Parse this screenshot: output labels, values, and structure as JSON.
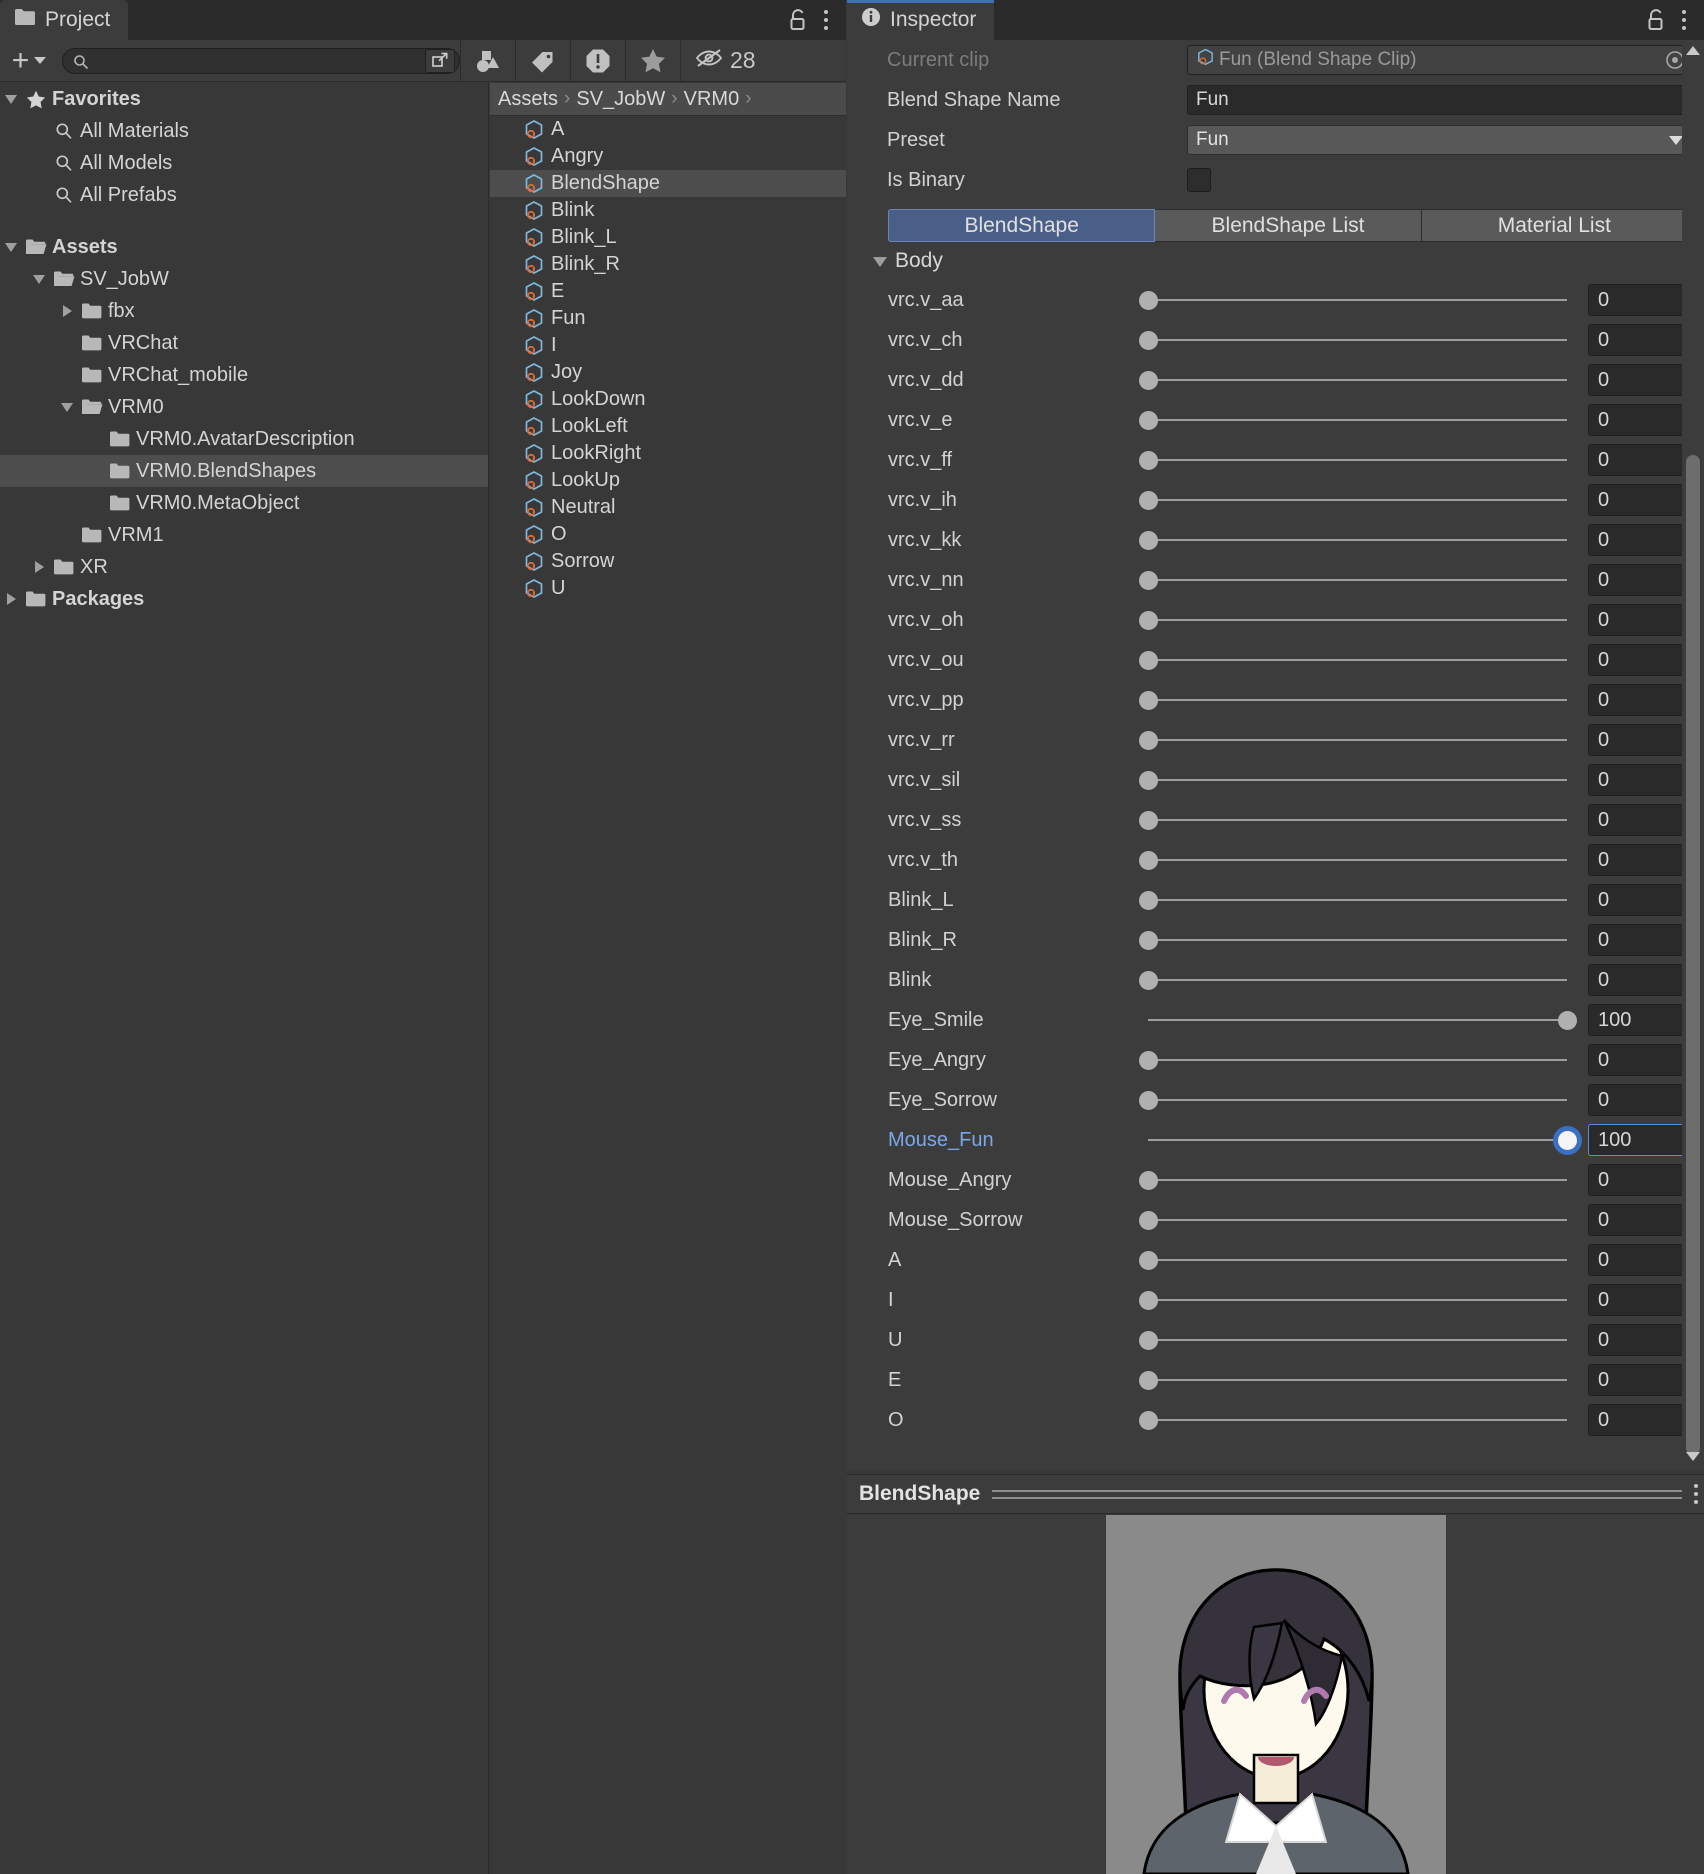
{
  "project_panel": {
    "tab_label": "Project",
    "tab_icon": "folder-icon",
    "lock_icon": "lock-open-icon",
    "menu_icon": "kebab-menu-icon",
    "toolbar": {
      "create_label": "+",
      "create_dropdown_icon": "chevron-down-icon",
      "search_value": "",
      "search_placeholder": "",
      "search_icon": "search-icon",
      "search_expand_icon": "open-in-new-window-icon",
      "filter_type_icon": "shapes-filter-icon",
      "filter_label_icon": "tag-filter-icon",
      "filter_warning_icon": "warning-octagon-icon",
      "filter_favorite_icon": "star-filter-icon",
      "hidden_icon": "eye-slash-icon",
      "hidden_count": "28"
    },
    "tree": [
      {
        "label": "Favorites",
        "icon": "star-icon",
        "indent": 0,
        "expander": "down",
        "bold": true,
        "selected": false
      },
      {
        "label": "All Materials",
        "icon": "search-icon",
        "indent": 1,
        "expander": "none",
        "bold": false,
        "selected": false
      },
      {
        "label": "All Models",
        "icon": "search-icon",
        "indent": 1,
        "expander": "none",
        "bold": false,
        "selected": false
      },
      {
        "label": "All Prefabs",
        "icon": "search-icon",
        "indent": 1,
        "expander": "none",
        "bold": false,
        "selected": false
      },
      {
        "label": "",
        "icon": "none",
        "indent": 0,
        "expander": "none",
        "bold": false,
        "selected": false
      },
      {
        "label": "Assets",
        "icon": "folder-open-icon",
        "indent": 0,
        "expander": "down",
        "bold": true,
        "selected": false
      },
      {
        "label": "SV_JobW",
        "icon": "folder-open-icon",
        "indent": 1,
        "expander": "down",
        "bold": false,
        "selected": false
      },
      {
        "label": "fbx",
        "icon": "folder-icon",
        "indent": 2,
        "expander": "right",
        "bold": false,
        "selected": false
      },
      {
        "label": "VRChat",
        "icon": "folder-icon",
        "indent": 2,
        "expander": "none",
        "bold": false,
        "selected": false
      },
      {
        "label": "VRChat_mobile",
        "icon": "folder-icon",
        "indent": 2,
        "expander": "none",
        "bold": false,
        "selected": false
      },
      {
        "label": "VRM0",
        "icon": "folder-open-icon",
        "indent": 2,
        "expander": "down",
        "bold": false,
        "selected": false
      },
      {
        "label": "VRM0.AvatarDescription",
        "icon": "folder-icon",
        "indent": 3,
        "expander": "none",
        "bold": false,
        "selected": false
      },
      {
        "label": "VRM0.BlendShapes",
        "icon": "folder-icon",
        "indent": 3,
        "expander": "none",
        "bold": false,
        "selected": true
      },
      {
        "label": "VRM0.MetaObject",
        "icon": "folder-icon",
        "indent": 3,
        "expander": "none",
        "bold": false,
        "selected": false
      },
      {
        "label": "VRM1",
        "icon": "folder-icon",
        "indent": 2,
        "expander": "none",
        "bold": false,
        "selected": false
      },
      {
        "label": "XR",
        "icon": "folder-icon",
        "indent": 1,
        "expander": "right",
        "bold": false,
        "selected": false
      },
      {
        "label": "Packages",
        "icon": "folder-icon",
        "indent": 0,
        "expander": "right",
        "bold": true,
        "selected": false
      }
    ],
    "breadcrumb": [
      "Assets",
      "SV_JobW",
      "VRM0"
    ],
    "breadcrumb_overflow_icon": "chevron-right-icon",
    "assets": [
      {
        "label": "A",
        "icon": "scriptable-object-icon",
        "selected": false
      },
      {
        "label": "Angry",
        "icon": "scriptable-object-icon",
        "selected": false
      },
      {
        "label": "BlendShape",
        "icon": "scriptable-object-icon",
        "selected": true
      },
      {
        "label": "Blink",
        "icon": "scriptable-object-icon",
        "selected": false
      },
      {
        "label": "Blink_L",
        "icon": "scriptable-object-icon",
        "selected": false
      },
      {
        "label": "Blink_R",
        "icon": "scriptable-object-icon",
        "selected": false
      },
      {
        "label": "E",
        "icon": "scriptable-object-icon",
        "selected": false
      },
      {
        "label": "Fun",
        "icon": "scriptable-object-icon",
        "selected": false
      },
      {
        "label": "I",
        "icon": "scriptable-object-icon",
        "selected": false
      },
      {
        "label": "Joy",
        "icon": "scriptable-object-icon",
        "selected": false
      },
      {
        "label": "LookDown",
        "icon": "scriptable-object-icon",
        "selected": false
      },
      {
        "label": "LookLeft",
        "icon": "scriptable-object-icon",
        "selected": false
      },
      {
        "label": "LookRight",
        "icon": "scriptable-object-icon",
        "selected": false
      },
      {
        "label": "LookUp",
        "icon": "scriptable-object-icon",
        "selected": false
      },
      {
        "label": "Neutral",
        "icon": "scriptable-object-icon",
        "selected": false
      },
      {
        "label": "O",
        "icon": "scriptable-object-icon",
        "selected": false
      },
      {
        "label": "Sorrow",
        "icon": "scriptable-object-icon",
        "selected": false
      },
      {
        "label": "U",
        "icon": "scriptable-object-icon",
        "selected": false
      }
    ]
  },
  "inspector": {
    "tab_label": "Inspector",
    "tab_icon": "info-circle-icon",
    "lock_icon": "lock-open-icon",
    "menu_icon": "kebab-menu-icon",
    "fields": {
      "current_clip_label": "Current clip",
      "current_clip_value": "Fun (Blend Shape Clip)",
      "current_clip_icon": "scriptable-object-icon",
      "current_clip_picker_icon": "object-picker-icon",
      "blend_shape_name_label": "Blend Shape Name",
      "blend_shape_name_value": "Fun",
      "preset_label": "Preset",
      "preset_value": "Fun",
      "preset_dropdown_icon": "dropdown-arrow-icon",
      "is_binary_label": "Is Binary",
      "is_binary_checked": false
    },
    "tabs": [
      {
        "label": "BlendShape",
        "active": true
      },
      {
        "label": "BlendShape List",
        "active": false
      },
      {
        "label": "Material List",
        "active": false
      }
    ],
    "foldout": {
      "label": "Body",
      "expanded": true,
      "icon": "triangle-down-icon"
    },
    "blendshapes": [
      {
        "name": "vrc.v_aa",
        "value": "0",
        "percent": 0,
        "selected": false
      },
      {
        "name": "vrc.v_ch",
        "value": "0",
        "percent": 0,
        "selected": false
      },
      {
        "name": "vrc.v_dd",
        "value": "0",
        "percent": 0,
        "selected": false
      },
      {
        "name": "vrc.v_e",
        "value": "0",
        "percent": 0,
        "selected": false
      },
      {
        "name": "vrc.v_ff",
        "value": "0",
        "percent": 0,
        "selected": false
      },
      {
        "name": "vrc.v_ih",
        "value": "0",
        "percent": 0,
        "selected": false
      },
      {
        "name": "vrc.v_kk",
        "value": "0",
        "percent": 0,
        "selected": false
      },
      {
        "name": "vrc.v_nn",
        "value": "0",
        "percent": 0,
        "selected": false
      },
      {
        "name": "vrc.v_oh",
        "value": "0",
        "percent": 0,
        "selected": false
      },
      {
        "name": "vrc.v_ou",
        "value": "0",
        "percent": 0,
        "selected": false
      },
      {
        "name": "vrc.v_pp",
        "value": "0",
        "percent": 0,
        "selected": false
      },
      {
        "name": "vrc.v_rr",
        "value": "0",
        "percent": 0,
        "selected": false
      },
      {
        "name": "vrc.v_sil",
        "value": "0",
        "percent": 0,
        "selected": false
      },
      {
        "name": "vrc.v_ss",
        "value": "0",
        "percent": 0,
        "selected": false
      },
      {
        "name": "vrc.v_th",
        "value": "0",
        "percent": 0,
        "selected": false
      },
      {
        "name": "Blink_L",
        "value": "0",
        "percent": 0,
        "selected": false
      },
      {
        "name": "Blink_R",
        "value": "0",
        "percent": 0,
        "selected": false
      },
      {
        "name": "Blink",
        "value": "0",
        "percent": 0,
        "selected": false
      },
      {
        "name": "Eye_Smile",
        "value": "100",
        "percent": 100,
        "selected": false
      },
      {
        "name": "Eye_Angry",
        "value": "0",
        "percent": 0,
        "selected": false
      },
      {
        "name": "Eye_Sorrow",
        "value": "0",
        "percent": 0,
        "selected": false
      },
      {
        "name": "Mouse_Fun",
        "value": "100",
        "percent": 100,
        "selected": true
      },
      {
        "name": "Mouse_Angry",
        "value": "0",
        "percent": 0,
        "selected": false
      },
      {
        "name": "Mouse_Sorrow",
        "value": "0",
        "percent": 0,
        "selected": false
      },
      {
        "name": "A",
        "value": "0",
        "percent": 0,
        "selected": false
      },
      {
        "name": "I",
        "value": "0",
        "percent": 0,
        "selected": false
      },
      {
        "name": "U",
        "value": "0",
        "percent": 0,
        "selected": false
      },
      {
        "name": "E",
        "value": "0",
        "percent": 0,
        "selected": false
      },
      {
        "name": "O",
        "value": "0",
        "percent": 0,
        "selected": false
      }
    ],
    "scrollbar": {
      "up_icon": "scroll-up-arrow-icon",
      "down_icon": "scroll-down-arrow-icon"
    },
    "preview": {
      "title": "BlendShape",
      "menu_icon": "kebab-menu-icon",
      "image_alt": "avatar-face-preview"
    }
  },
  "colors": {
    "window_bg": "#383838",
    "panel_bg": "#3c3c3c",
    "tabstrip_bg": "#2b2b2b",
    "selection": "#4d4d4d",
    "accent_blue": "#4a5f87",
    "accent_focus": "#5b8dd6",
    "selected_label": "#7ba7e8",
    "asset_icon_blue": "#7fb8de",
    "asset_icon_orange": "#d96b3a"
  }
}
